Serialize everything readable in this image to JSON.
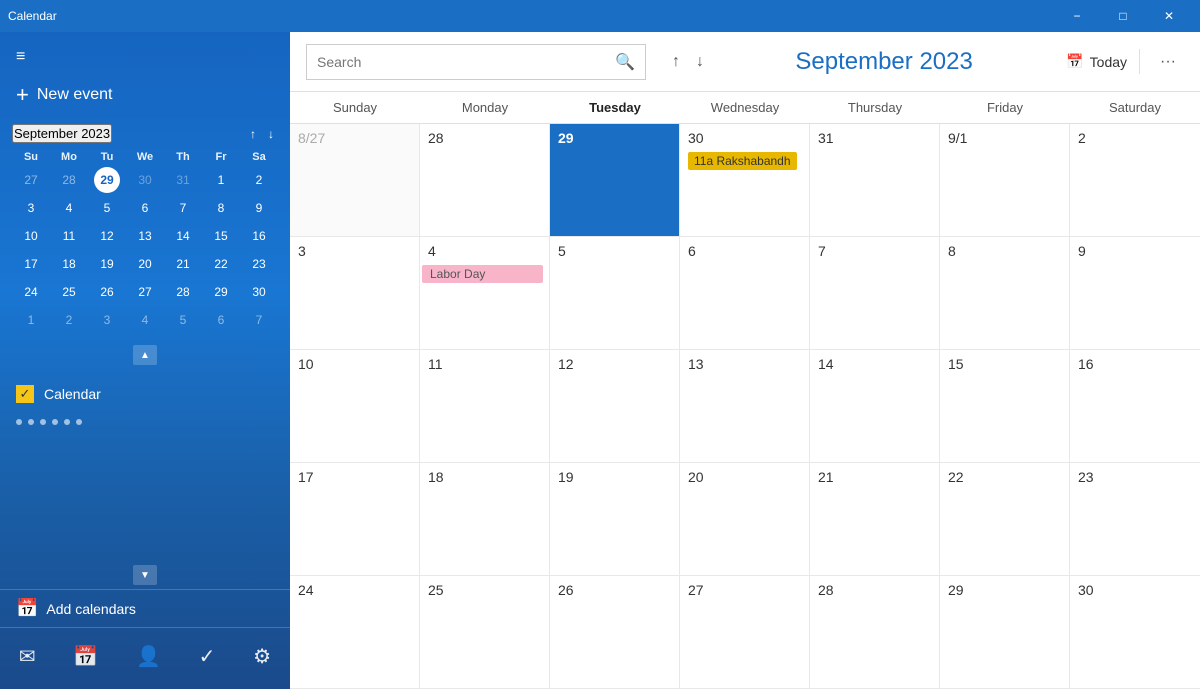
{
  "app": {
    "title": "Calendar"
  },
  "titlebar": {
    "title": "Calendar",
    "minimize_label": "−",
    "maximize_label": "□",
    "close_label": "✕"
  },
  "sidebar": {
    "hamburger_icon": "≡",
    "new_event_label": "New event",
    "new_event_icon": "+",
    "mini_calendar": {
      "title": "September 2023",
      "prev_icon": "↑",
      "next_icon": "↓",
      "weekdays": [
        "Su",
        "Mo",
        "Tu",
        "We",
        "Th",
        "Fr",
        "Sa"
      ],
      "rows": [
        [
          "27",
          "28",
          "29",
          "30",
          "31",
          "1",
          "2"
        ],
        [
          "3",
          "4",
          "5",
          "6",
          "7",
          "8",
          "9"
        ],
        [
          "10",
          "11",
          "12",
          "13",
          "14",
          "15",
          "16"
        ],
        [
          "17",
          "18",
          "19",
          "20",
          "21",
          "22",
          "23"
        ],
        [
          "24",
          "25",
          "26",
          "27",
          "28",
          "29",
          "30"
        ],
        [
          "1",
          "2",
          "3",
          "4",
          "5",
          "6",
          "7"
        ]
      ],
      "other_month_indices": [
        0,
        1,
        5,
        6,
        35,
        36,
        37,
        38,
        39,
        40,
        41
      ],
      "selected_index": 2,
      "selected_day": "29"
    },
    "scroll_up_icon": "▲",
    "scroll_down_icon": "▼",
    "calendars": [
      {
        "name": "Calendar",
        "checked": true
      }
    ],
    "add_calendar_label": "Add calendars",
    "add_calendar_icon": "+",
    "nav_items": [
      {
        "icon": "✉",
        "name": "mail-nav"
      },
      {
        "icon": "📅",
        "name": "calendar-nav"
      },
      {
        "icon": "👤",
        "name": "people-nav"
      },
      {
        "icon": "✓",
        "name": "tasks-nav"
      },
      {
        "icon": "⚙",
        "name": "settings-nav"
      }
    ]
  },
  "toolbar": {
    "search_placeholder": "Search",
    "search_icon": "🔍",
    "nav_up_icon": "↑",
    "nav_down_icon": "↓",
    "month_title": "September 2023",
    "today_label": "Today",
    "today_icon": "📅",
    "more_icon": "···"
  },
  "calendar": {
    "weekdays": [
      {
        "label": "Sunday",
        "bold": false
      },
      {
        "label": "Monday",
        "bold": false
      },
      {
        "label": "Tuesday",
        "bold": true
      },
      {
        "label": "Wednesday",
        "bold": false
      },
      {
        "label": "Thursday",
        "bold": false
      },
      {
        "label": "Friday",
        "bold": false
      },
      {
        "label": "Saturday",
        "bold": false
      }
    ],
    "weeks": [
      {
        "days": [
          {
            "date": "8/27",
            "other": true,
            "today": false,
            "events": []
          },
          {
            "date": "28",
            "other": false,
            "today": false,
            "events": []
          },
          {
            "date": "29",
            "other": false,
            "today": true,
            "events": []
          },
          {
            "date": "30",
            "other": false,
            "today": false,
            "events": [
              {
                "label": "11a Rakshabandh",
                "type": "gold"
              }
            ]
          },
          {
            "date": "31",
            "other": false,
            "today": false,
            "events": []
          },
          {
            "date": "9/1",
            "other": false,
            "today": false,
            "events": []
          },
          {
            "date": "2",
            "other": false,
            "today": false,
            "events": []
          }
        ]
      },
      {
        "days": [
          {
            "date": "3",
            "other": false,
            "today": false,
            "events": []
          },
          {
            "date": "4",
            "other": false,
            "today": false,
            "events": [
              {
                "label": "Labor Day",
                "type": "pink"
              }
            ]
          },
          {
            "date": "5",
            "other": false,
            "today": false,
            "events": []
          },
          {
            "date": "6",
            "other": false,
            "today": false,
            "events": []
          },
          {
            "date": "7",
            "other": false,
            "today": false,
            "events": []
          },
          {
            "date": "8",
            "other": false,
            "today": false,
            "events": []
          },
          {
            "date": "9",
            "other": false,
            "today": false,
            "events": []
          }
        ]
      },
      {
        "days": [
          {
            "date": "10",
            "other": false,
            "today": false,
            "events": []
          },
          {
            "date": "11",
            "other": false,
            "today": false,
            "events": []
          },
          {
            "date": "12",
            "other": false,
            "today": false,
            "events": []
          },
          {
            "date": "13",
            "other": false,
            "today": false,
            "events": []
          },
          {
            "date": "14",
            "other": false,
            "today": false,
            "events": []
          },
          {
            "date": "15",
            "other": false,
            "today": false,
            "events": []
          },
          {
            "date": "16",
            "other": false,
            "today": false,
            "events": []
          }
        ]
      },
      {
        "days": [
          {
            "date": "17",
            "other": false,
            "today": false,
            "events": []
          },
          {
            "date": "18",
            "other": false,
            "today": false,
            "events": []
          },
          {
            "date": "19",
            "other": false,
            "today": false,
            "events": []
          },
          {
            "date": "20",
            "other": false,
            "today": false,
            "events": []
          },
          {
            "date": "21",
            "other": false,
            "today": false,
            "events": []
          },
          {
            "date": "22",
            "other": false,
            "today": false,
            "events": []
          },
          {
            "date": "23",
            "other": false,
            "today": false,
            "events": []
          }
        ]
      },
      {
        "days": [
          {
            "date": "24",
            "other": false,
            "today": false,
            "events": []
          },
          {
            "date": "25",
            "other": false,
            "today": false,
            "events": []
          },
          {
            "date": "26",
            "other": false,
            "today": false,
            "events": []
          },
          {
            "date": "27",
            "other": false,
            "today": false,
            "events": []
          },
          {
            "date": "28",
            "other": false,
            "today": false,
            "events": []
          },
          {
            "date": "29",
            "other": false,
            "today": false,
            "events": []
          },
          {
            "date": "30",
            "other": false,
            "today": false,
            "events": []
          }
        ]
      }
    ]
  }
}
